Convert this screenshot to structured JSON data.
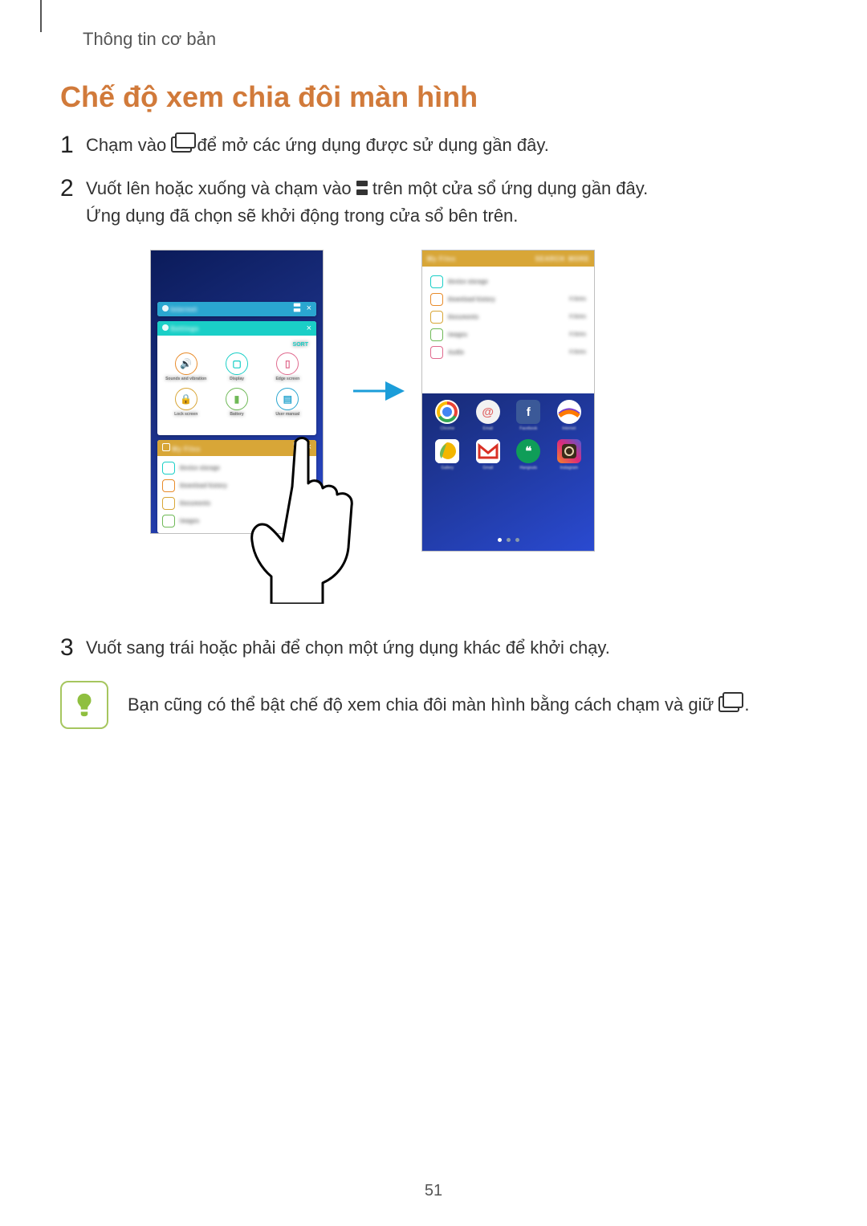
{
  "section": "Thông tin cơ bản",
  "heading": "Chế độ xem chia đôi màn hình",
  "steps": {
    "s1": {
      "num": "1",
      "a": "Chạm vào ",
      "b": " để mở các ứng dụng được sử dụng gần đây."
    },
    "s2": {
      "num": "2",
      "a": "Vuốt lên hoặc xuống và chạm vào ",
      "b": " trên một cửa sổ ứng dụng gần đây.",
      "c": "Ứng dụng đã chọn sẽ khởi động trong cửa sổ bên trên."
    },
    "s3": {
      "num": "3",
      "a": "Vuốt sang trái hoặc phải để chọn một ứng dụng khác để khởi chạy."
    }
  },
  "note": {
    "a": "Bạn cũng có thể bật chế độ xem chia đôi màn hình bằng cách chạm và giữ ",
    "b": "."
  },
  "page": "51",
  "fig": {
    "card_blue": "Internet",
    "card_teal": "Settings",
    "sort": "SORT",
    "files_title": "My Files",
    "tb_search": "SEARCH",
    "tb_more": "MORE",
    "rows": [
      {
        "label": "Device storage",
        "meta": ""
      },
      {
        "label": "Download history",
        "meta": "0 items"
      },
      {
        "label": "Documents",
        "meta": "0 items"
      },
      {
        "label": "Images",
        "meta": "0 items"
      },
      {
        "label": "Audio",
        "meta": "0 items"
      }
    ],
    "apps": [
      "Chrome",
      "Email",
      "Facebook",
      "Internet",
      "Gallery",
      "Gmail",
      "Hangouts",
      "Instagram"
    ]
  }
}
